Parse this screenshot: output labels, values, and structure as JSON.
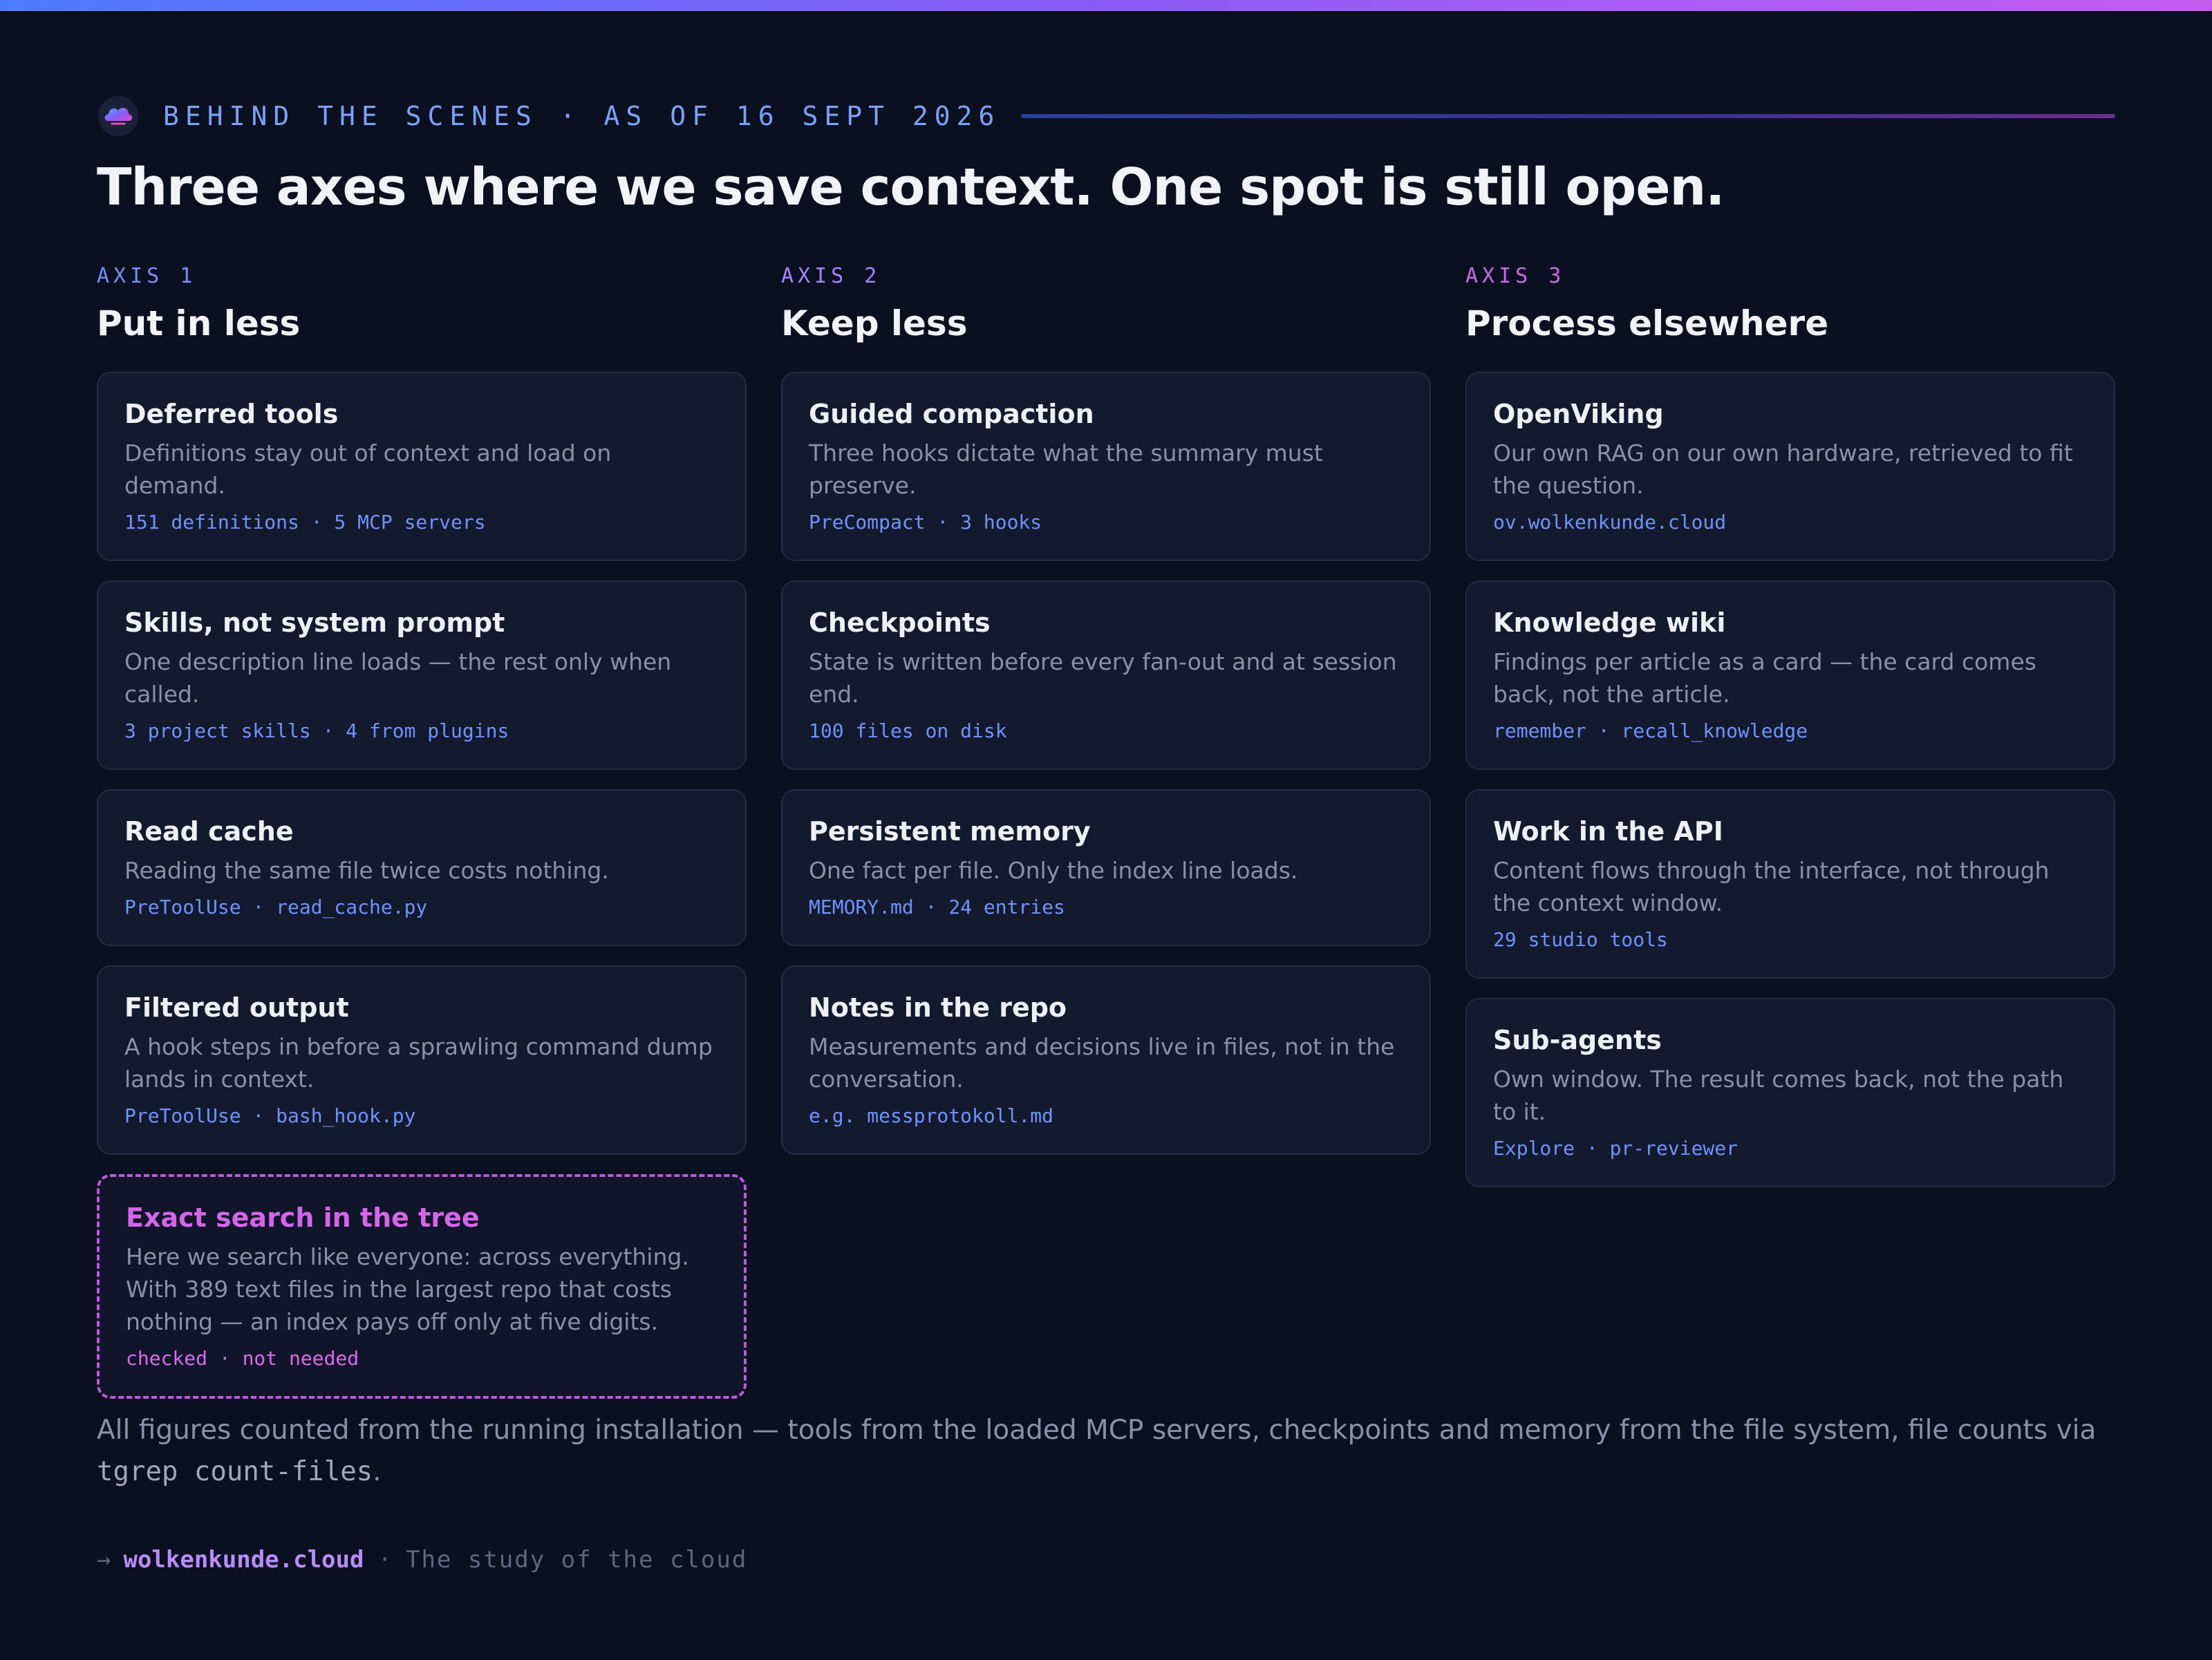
{
  "header": {
    "kicker": "BEHIND THE SCENES · AS OF 16 SEPT 2026",
    "headline": "Three axes where we save context. One spot is still open."
  },
  "axes": [
    {
      "label": "AXIS 1",
      "title": "Put in less",
      "cards": [
        {
          "title": "Deferred tools",
          "desc": "Definitions stay out of context and load on demand.",
          "meta": "151 definitions · 5 MCP servers"
        },
        {
          "title": "Skills, not system prompt",
          "desc": "One description line loads — the rest only when called.",
          "meta": "3 project skills · 4 from plugins"
        },
        {
          "title": "Read cache",
          "desc": "Reading the same file twice costs nothing.",
          "meta": "PreToolUse · read_cache.py"
        },
        {
          "title": "Filtered output",
          "desc": "A hook steps in before a sprawling command dump lands in context.",
          "meta": "PreToolUse · bash_hook.py"
        },
        {
          "title": "Exact search in the tree",
          "desc": "Here we search like everyone: across everything. With 389 text files in the largest repo that costs nothing — an index pays off only at five digits.",
          "meta": "checked · not needed"
        }
      ]
    },
    {
      "label": "AXIS 2",
      "title": "Keep less",
      "cards": [
        {
          "title": "Guided compaction",
          "desc": "Three hooks dictate what the summary must preserve.",
          "meta": "PreCompact · 3 hooks"
        },
        {
          "title": "Checkpoints",
          "desc": "State is written before every fan-out and at session end.",
          "meta": "100 files on disk"
        },
        {
          "title": "Persistent memory",
          "desc": "One fact per file. Only the index line loads.",
          "meta": "MEMORY.md · 24 entries"
        },
        {
          "title": "Notes in the repo",
          "desc": "Measurements and decisions live in files, not in the conversation.",
          "meta": "e.g. messprotokoll.md"
        }
      ]
    },
    {
      "label": "AXIS 3",
      "title": "Process elsewhere",
      "cards": [
        {
          "title": "OpenViking",
          "desc": "Our own RAG on our own hardware, retrieved to fit the question.",
          "meta": "ov.wolkenkunde.cloud"
        },
        {
          "title": "Knowledge wiki",
          "desc": "Findings per article as a card — the card comes back, not the article.",
          "meta": "remember · recall_knowledge"
        },
        {
          "title": "Work in the API",
          "desc": "Content flows through the interface, not through the context window.",
          "meta": "29 studio tools"
        },
        {
          "title": "Sub-agents",
          "desc": "Own window. The result comes back, not the path to it.",
          "meta": "Explore · pr-reviewer"
        }
      ]
    }
  ],
  "footnote": {
    "text": "All figures counted from the running installation — tools from the loaded MCP servers, checkpoints and memory from the file system, file counts via ",
    "command": "tgrep count-files",
    "end": "."
  },
  "footer": {
    "arrow": "→",
    "domain": "wolkenkunde.cloud",
    "separator": "·",
    "tagline": "The study of the cloud"
  },
  "icons": {
    "logo": "cloud-logo-icon"
  },
  "colors": {
    "background": "#0b1020",
    "accent_blue": "#7aa2ff",
    "accent_purple": "#b98cff",
    "open_magenta": "#d465ea"
  }
}
